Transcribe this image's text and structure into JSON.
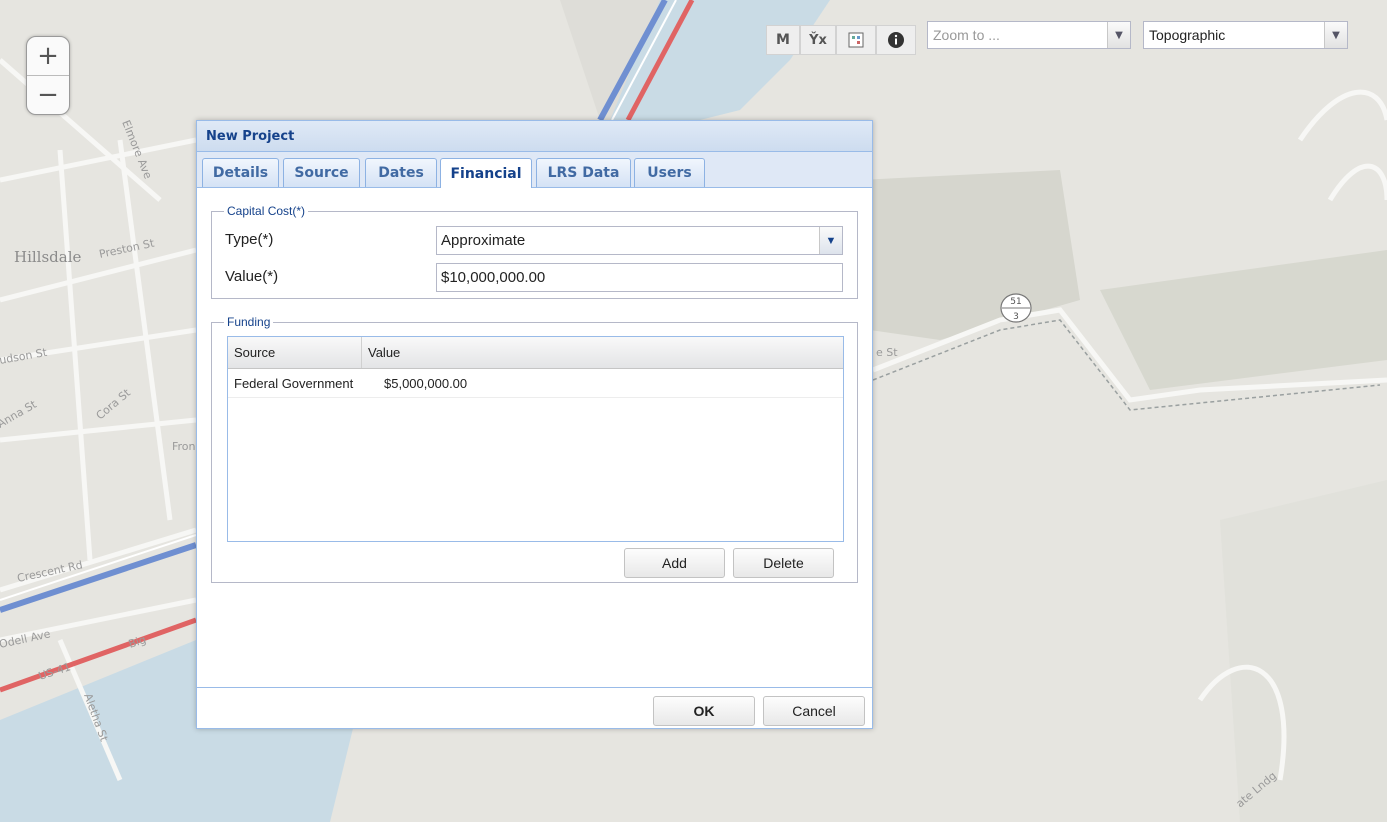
{
  "map": {
    "labels": {
      "hillsdale": "Hillsdale",
      "preston": "Preston St",
      "elmore": "Elmore Ave",
      "hudson": "udson St",
      "anna": "Anna St",
      "cora": "Cora St",
      "front": "Fron",
      "crescent": "Crescent Rd",
      "odell": "Odell Ave",
      "aletha": "Aletha St",
      "us": "US-41",
      "big": "Big",
      "route_top": "51",
      "route_bottom": "3",
      "right_st": "e St",
      "landing": "ate Lndg"
    }
  },
  "zoom": {
    "in_label": "+",
    "out_label": "−"
  },
  "toolbar": {
    "m_label": "M",
    "yx_label": "Y̌x",
    "zoom_to_placeholder": "Zoom to ...",
    "basemap_value": "Topographic"
  },
  "dialog": {
    "title": "New Project",
    "tabs": [
      "Details",
      "Source",
      "Dates",
      "Financial",
      "LRS Data",
      "Users"
    ],
    "active_tab": "Financial",
    "capital_cost": {
      "legend": "Capital Cost(*)",
      "type_label": "Type(*)",
      "type_value": "Approximate",
      "value_label": "Value(*)",
      "value_value": "$10,000,000.00"
    },
    "funding": {
      "legend": "Funding",
      "columns": [
        "Source",
        "Value"
      ],
      "rows": [
        {
          "source": "Federal Government",
          "value": "$5,000,000.00"
        }
      ],
      "add_label": "Add",
      "delete_label": "Delete"
    },
    "ok_label": "OK",
    "cancel_label": "Cancel"
  }
}
